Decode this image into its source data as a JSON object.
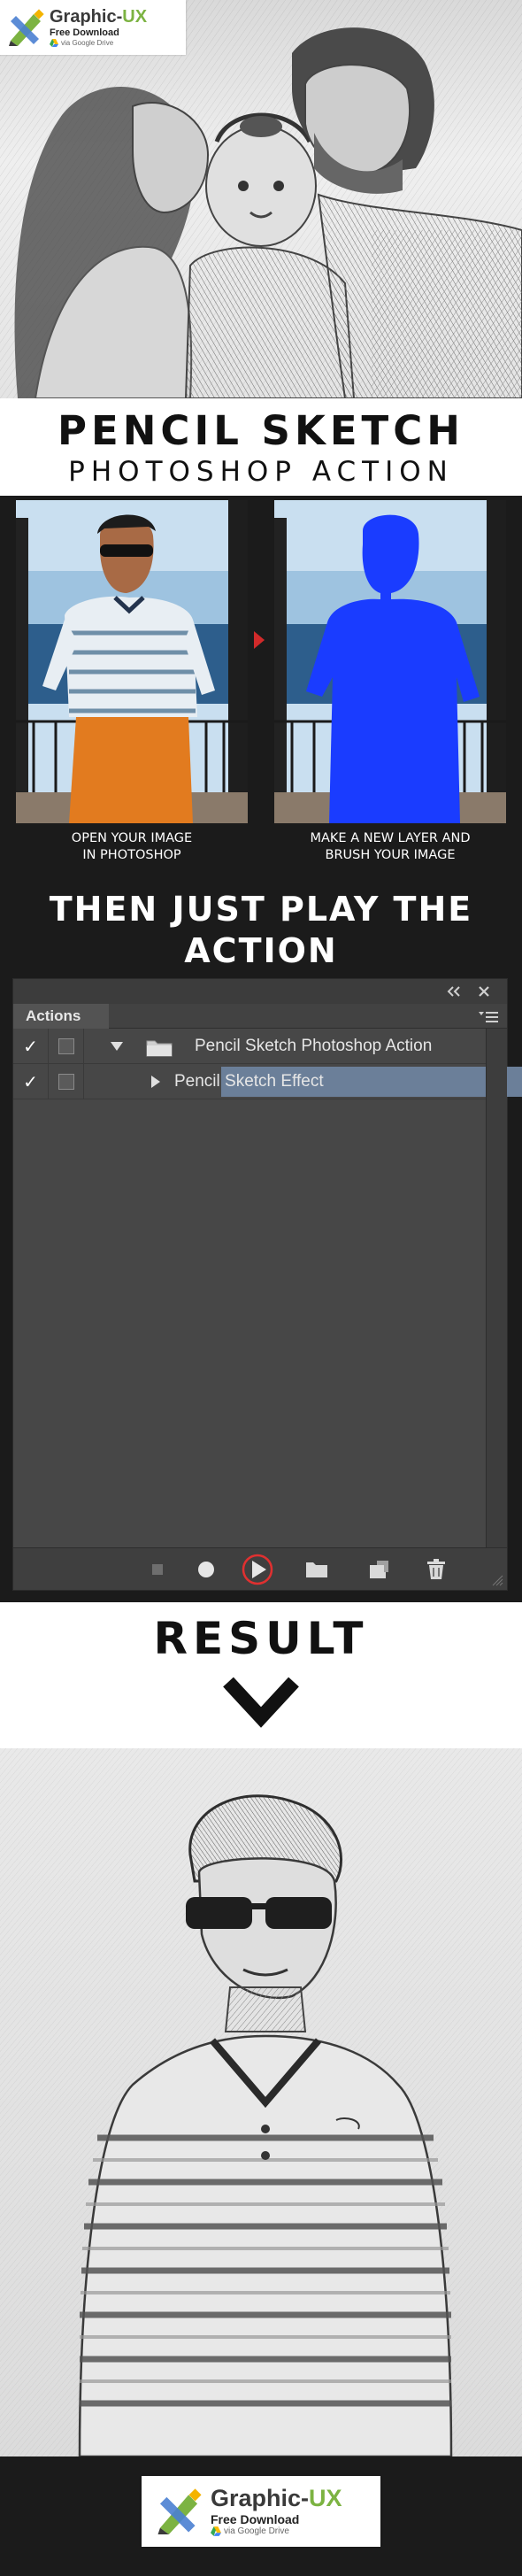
{
  "logo": {
    "name_prefix": "Graphic-",
    "name_suffix": "UX",
    "tagline": "Free Download",
    "source": "via Google Drive",
    "accent_color": "#7cb342"
  },
  "title": {
    "line1": "PENCIL SKETCH",
    "line2": "PHOTOSHOP ACTION"
  },
  "steps": {
    "step1_caption": "OPEN YOUR IMAGE\nIN PHOTOSHOP",
    "step2_caption": "MAKE A NEW LAYER AND\nBRUSH YOUR IMAGE",
    "arrow_icon": "chevron-right-icon",
    "brush_color": "#1a3cff",
    "play_heading_line1": "THEN JUST PLAY THE",
    "play_heading_line2": "ACTION"
  },
  "actions_panel": {
    "tab_label": "Actions",
    "collapse_icon": "double-chevron-left-icon",
    "close_icon": "close-icon",
    "menu_icon": "panel-menu-icon",
    "set_row": {
      "checked": "✓",
      "expand_icon": "triangle-down-icon",
      "folder_icon": "folder-icon",
      "label": "Pencil Sketch Photoshop Action"
    },
    "action_row": {
      "checked": "✓",
      "expand_icon": "triangle-right-icon",
      "label": "Pencil Sketch Effect",
      "selection_color": "#6b7f99"
    },
    "bottom_buttons": [
      "stop-icon",
      "record-icon",
      "play-icon",
      "folder-icon",
      "new-action-icon",
      "trash-icon"
    ],
    "highlight_color": "#e03030"
  },
  "result": {
    "heading": "RESULT",
    "chevron_icon": "chevron-down-icon"
  }
}
